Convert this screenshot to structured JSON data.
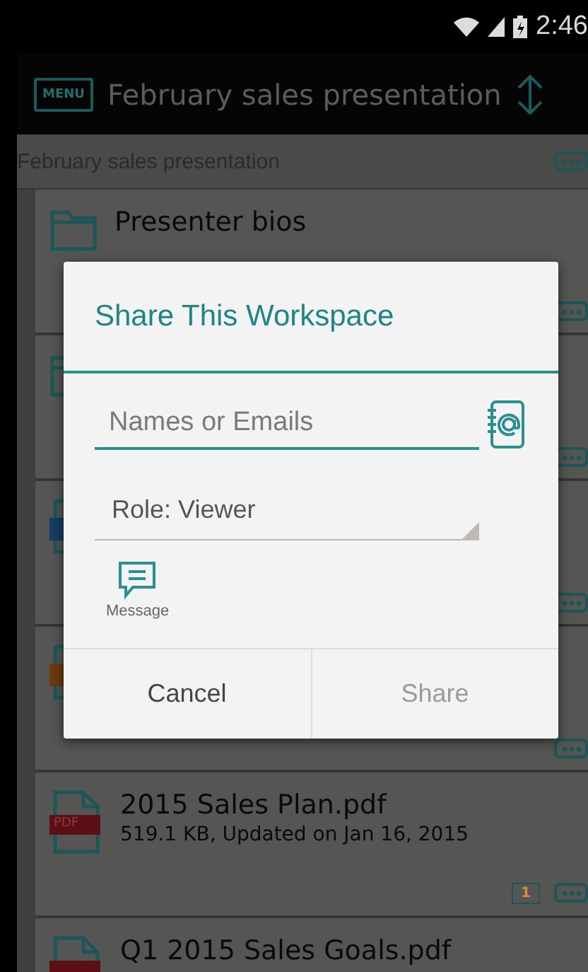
{
  "status_bar": {
    "time": "2:46"
  },
  "app_bar": {
    "menu_label": "MENU",
    "title": "February sales presentation"
  },
  "breadcrumb": {
    "label": "February sales presentation"
  },
  "rows": [
    {
      "kind": "folder",
      "name": "Presenter bios"
    },
    {
      "kind": "folder"
    },
    {
      "kind": "doc"
    },
    {
      "kind": "slides"
    },
    {
      "kind": "pdf",
      "badge": "PDF",
      "name": "2015 Sales Plan.pdf",
      "meta": "519.1 KB, Updated on Jan 16, 2015",
      "comment_count": "1"
    },
    {
      "kind": "pdf",
      "name": "Q1 2015 Sales Goals.pdf"
    }
  ],
  "dialog": {
    "title": "Share This Workspace",
    "recipients": {
      "placeholder": "Names or Emails"
    },
    "role": "Role: Viewer",
    "message_label": "Message",
    "buttons": [
      {
        "label": "Cancel",
        "disabled": false
      },
      {
        "label": "Share",
        "disabled": true
      }
    ]
  }
}
